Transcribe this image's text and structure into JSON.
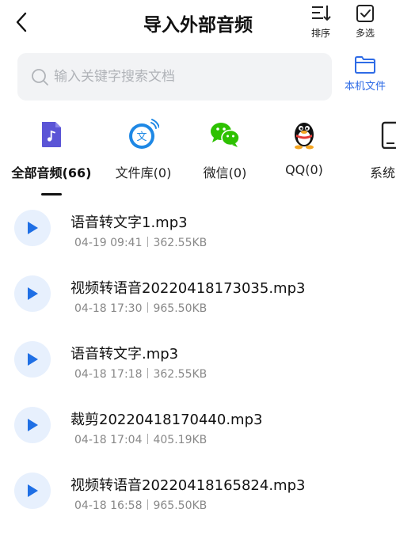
{
  "header": {
    "title": "导入外部音频",
    "sort_label": "排序",
    "multi_select_label": "多选"
  },
  "search": {
    "placeholder": "输入关键字搜索文档",
    "value": ""
  },
  "local_files": {
    "label": "本机文件"
  },
  "categories": [
    {
      "label": "全部音频(66)",
      "icon": "music-note-icon",
      "active": true
    },
    {
      "label": "文件库(0)",
      "icon": "file-library-icon"
    },
    {
      "label": "微信(0)",
      "icon": "wechat-icon"
    },
    {
      "label": "QQ(0)",
      "icon": "qq-penguin-icon"
    },
    {
      "label": "系统录",
      "icon": "phone-icon"
    }
  ],
  "files": [
    {
      "name": "语音转文字1.mp3",
      "date": "04-19 09:41",
      "size": "362.55KB"
    },
    {
      "name": "视频转语音20220418173035.mp3",
      "date": "04-18 17:30",
      "size": "965.50KB"
    },
    {
      "name": "语音转文字.mp3",
      "date": "04-18 17:18",
      "size": "362.55KB"
    },
    {
      "name": "裁剪20220418170440.mp3",
      "date": "04-18 17:04",
      "size": "405.19KB"
    },
    {
      "name": "视频转语音20220418165824.mp3",
      "date": "04-18 16:58",
      "size": "965.50KB"
    }
  ],
  "colors": {
    "accent": "#2e6be6",
    "play_bg": "#e7f0fd",
    "music_icon": "#5b55d6",
    "wechat": "#2dc100",
    "search_bg": "#f2f3f5"
  }
}
